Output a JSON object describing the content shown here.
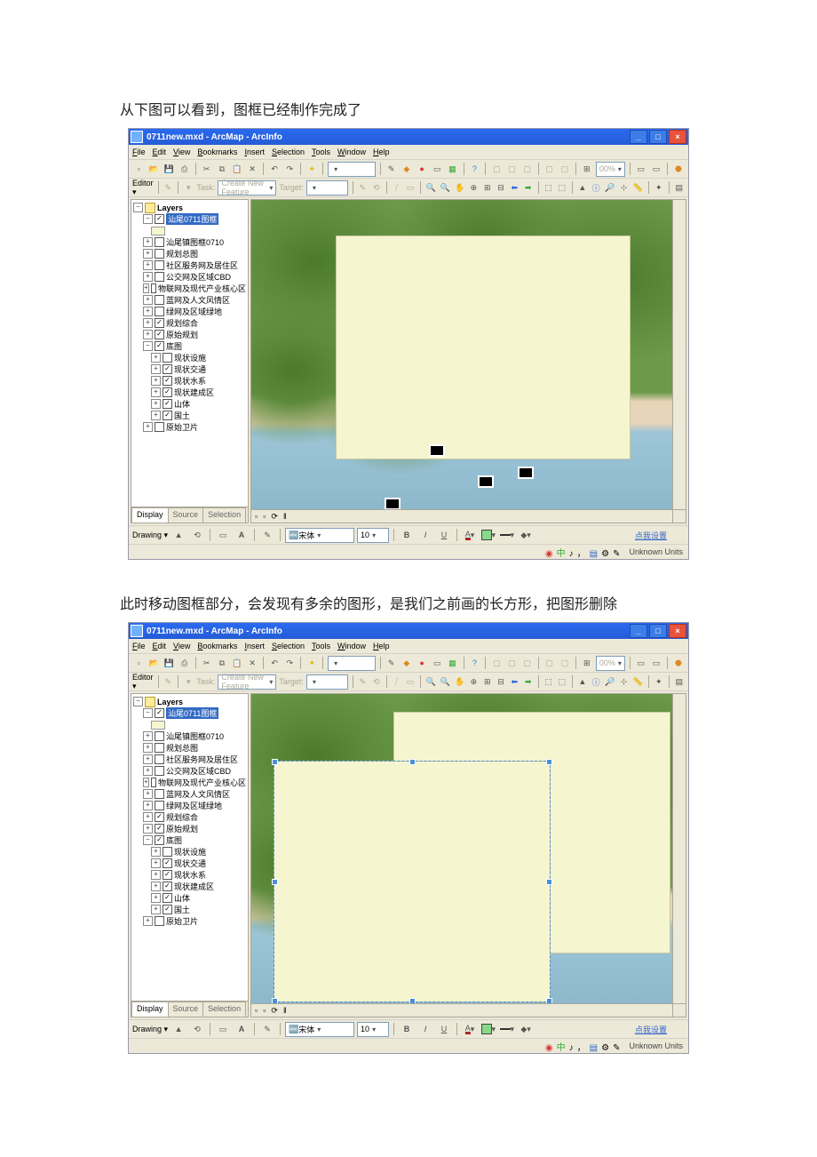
{
  "caption1": "从下图可以看到，图框已经制作完成了",
  "caption2": "此时移动图框部分，会发现有多余的图形，是我们之前画的长方形，把图形删除",
  "app": {
    "title": "0711new.mxd - ArcMap - ArcInfo",
    "menus": [
      "File",
      "Edit",
      "View",
      "Bookmarks",
      "Insert",
      "Selection",
      "Tools",
      "Window",
      "Help"
    ]
  },
  "toolbar2": {
    "editor": "Editor",
    "task": "Task:",
    "task_val": "Create New Feature",
    "target": "Target:"
  },
  "toc": {
    "root": "Layers",
    "active": "汕尾0711图框",
    "items": [
      {
        "chk": false,
        "label": "汕尾镇图框0710"
      },
      {
        "chk": false,
        "label": "规划总图"
      },
      {
        "chk": false,
        "label": "社区服务网及居住区"
      },
      {
        "chk": false,
        "label": "公交网及区域CBD"
      },
      {
        "chk": false,
        "label": "物联网及现代产业核心区"
      },
      {
        "chk": false,
        "label": "蓝网及人文风情区"
      },
      {
        "chk": false,
        "label": "绿网及区域绿地"
      },
      {
        "chk": true,
        "label": "规划综合"
      },
      {
        "chk": true,
        "label": "原始规划"
      },
      {
        "chk": true,
        "label": "底图",
        "children": [
          {
            "chk": false,
            "label": "现状设施"
          },
          {
            "chk": true,
            "label": "现状交通"
          },
          {
            "chk": true,
            "label": "现状水系"
          },
          {
            "chk": true,
            "label": "现状建成区"
          },
          {
            "chk": true,
            "label": "山体"
          },
          {
            "chk": true,
            "label": "国土"
          }
        ]
      },
      {
        "chk": false,
        "label": "原始卫片"
      }
    ],
    "tabs": [
      "Display",
      "Source",
      "Selection"
    ]
  },
  "drawing": {
    "label": "Drawing",
    "font": "宋体",
    "size": "10",
    "linkbtn": "点我设置"
  },
  "status": {
    "units": "Unknown Units"
  }
}
